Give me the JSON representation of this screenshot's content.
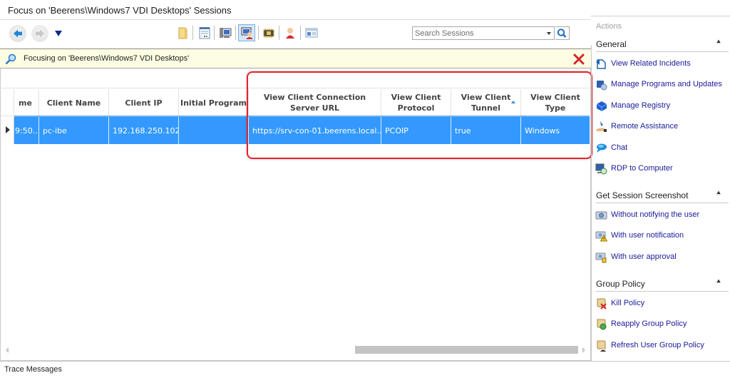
{
  "window": {
    "title": "Focus on 'Beerens\\Windows7 VDI Desktops' Sessions"
  },
  "toolbar": {
    "back_icon": "back-arrow-icon",
    "forward_icon": "forward-arrow-icon",
    "history_icon": "history-dropdown-icon",
    "buttons": [
      {
        "icon": "folder-icon"
      },
      {
        "icon": "notepad-icon"
      },
      {
        "icon": "computer-icon"
      },
      {
        "icon": "session-user-icon",
        "active": true
      },
      {
        "icon": "chip-icon"
      },
      {
        "icon": "user-icon"
      },
      {
        "icon": "window-icon"
      }
    ],
    "search": {
      "placeholder": "Search Sessions",
      "value": ""
    }
  },
  "focus_bar": {
    "text": "Focusing on 'Beerens\\Windows7 VDI Desktops'",
    "close_color": "#d42626"
  },
  "grid": {
    "columns": [
      {
        "label": "me"
      },
      {
        "label": "Client Name"
      },
      {
        "label": "Client IP"
      },
      {
        "label": "Initial Program"
      },
      {
        "label": "View Client Connection Server URL"
      },
      {
        "label": "View Client Protocol"
      },
      {
        "label": "View Client Tunnel",
        "sorted": "ascending"
      },
      {
        "label": "View Client Type"
      }
    ],
    "rows": [
      {
        "selected": true,
        "cells": [
          "9:50...",
          "pc-ibe",
          "192.168.250.102",
          "",
          "https://srv-con-01.beerens.local...",
          "PCOIP",
          "true",
          "Windows"
        ]
      }
    ],
    "selection_color": "#3399ff",
    "highlight_color": "#e8222a"
  },
  "actions": {
    "title": "Actions",
    "sections": [
      {
        "label": "General",
        "items": [
          {
            "label": "View Related Incidents",
            "icon": "incidents-icon"
          },
          {
            "label": "Manage Programs and Updates",
            "icon": "programs-icon"
          },
          {
            "label": "Manage Registry",
            "icon": "registry-icon"
          },
          {
            "label": "Remote Assistance",
            "icon": "remote-assistance-icon"
          },
          {
            "label": "Chat",
            "icon": "chat-icon"
          },
          {
            "label": "RDP to Computer",
            "icon": "rdp-icon"
          }
        ]
      },
      {
        "label": "Get Session Screenshot",
        "items": [
          {
            "label": "Without notifying the user",
            "icon": "camera-icon"
          },
          {
            "label": "With user notification",
            "icon": "camera-warning-icon"
          },
          {
            "label": "With user approval",
            "icon": "camera-approval-icon"
          }
        ]
      },
      {
        "label": "Group Policy",
        "items": [
          {
            "label": "Kill Policy",
            "icon": "kill-policy-icon"
          },
          {
            "label": "Reapply Group Policy",
            "icon": "reapply-policy-icon"
          },
          {
            "label": "Refresh User Group Policy",
            "icon": "refresh-policy-icon"
          }
        ]
      }
    ]
  },
  "trace": {
    "label": "Trace Messages"
  }
}
